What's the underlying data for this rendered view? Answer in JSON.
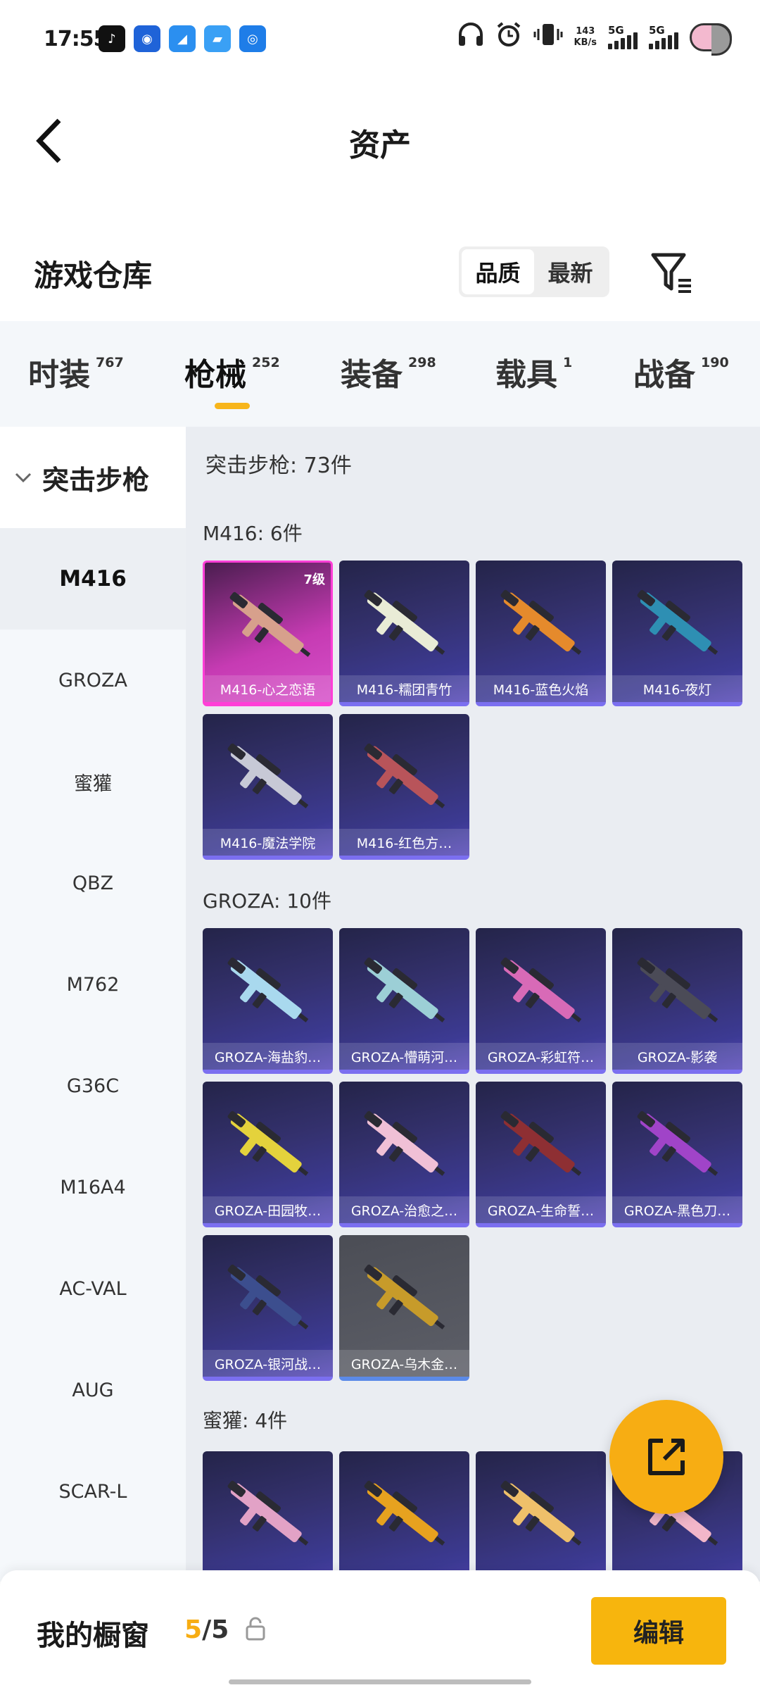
{
  "status_bar": {
    "time": "17:55",
    "net_speed_value": "143",
    "net_speed_unit": "KB/s",
    "sim1": "5G",
    "sim2": "5G",
    "app_icons": [
      "tiktok-icon",
      "chat-bot-icon",
      "blue-app-icon",
      "files-app-icon",
      "radio-app-icon"
    ],
    "system_icons": [
      "headphones-icon",
      "alarm-icon",
      "vibrate-icon",
      "cellular-signal-icon",
      "battery-cloud-icon"
    ]
  },
  "header": {
    "title": "资产"
  },
  "warehouse": {
    "title": "游戏仓库",
    "sort_options": [
      "品质",
      "最新"
    ],
    "active_sort": "品质"
  },
  "tabs": [
    {
      "label": "时装",
      "count": "767"
    },
    {
      "label": "枪械",
      "count": "252",
      "active": true
    },
    {
      "label": "装备",
      "count": "298"
    },
    {
      "label": "载具",
      "count": "1"
    },
    {
      "label": "战备",
      "count": "190"
    }
  ],
  "sidebar": {
    "category": "突击步枪",
    "items": [
      "M416",
      "GROZA",
      "蜜獾",
      "QBZ",
      "M762",
      "G36C",
      "M16A4",
      "AC-VAL",
      "AUG",
      "SCAR-L"
    ],
    "active": "M416"
  },
  "content": {
    "total_label": "突击步枪: 73件",
    "groups": [
      {
        "header": "M416: 6件",
        "items": [
          {
            "name": "M416-心之恋语",
            "level": "7级",
            "rarity": "pink",
            "gun_color": "#d7a08c"
          },
          {
            "name": "M416-糯团青竹",
            "rarity": "purple",
            "gun_color": "#e9ecd6"
          },
          {
            "name": "M416-蓝色火焰",
            "rarity": "purple",
            "gun_color": "#e58a2c"
          },
          {
            "name": "M416-夜灯",
            "rarity": "purple",
            "gun_color": "#2e8fb3"
          },
          {
            "name": "M416-魔法学院",
            "rarity": "purple",
            "gun_color": "#c7c9d6"
          },
          {
            "name": "M416-红色方…",
            "rarity": "purple",
            "gun_color": "#b8545a"
          }
        ]
      },
      {
        "header": "GROZA: 10件",
        "items": [
          {
            "name": "GROZA-海盐豹…",
            "rarity": "purple",
            "gun_color": "#a9d9ee"
          },
          {
            "name": "GROZA-懵萌河…",
            "rarity": "purple",
            "gun_color": "#9ccfd6"
          },
          {
            "name": "GROZA-彩虹符…",
            "rarity": "purple",
            "gun_color": "#d86ab7"
          },
          {
            "name": "GROZA-影袭",
            "rarity": "purple",
            "gun_color": "#4b4b57"
          },
          {
            "name": "GROZA-田园牧…",
            "rarity": "purple",
            "gun_color": "#e4d23c"
          },
          {
            "name": "GROZA-治愈之…",
            "rarity": "purple",
            "gun_color": "#f0c0d6"
          },
          {
            "name": "GROZA-生命誓…",
            "rarity": "purple",
            "gun_color": "#8e2f33"
          },
          {
            "name": "GROZA-黑色刀…",
            "rarity": "purple",
            "gun_color": "#a044c8"
          },
          {
            "name": "GROZA-银河战…",
            "rarity": "purple",
            "gun_color": "#3c4e8e"
          },
          {
            "name": "GROZA-乌木金…",
            "rarity": "grey",
            "gun_color": "#c79b2a"
          }
        ]
      },
      {
        "header": "蜜獾: 4件",
        "items": [
          {
            "name": "",
            "rarity": "purple",
            "gun_color": "#e2a2c6"
          },
          {
            "name": "",
            "rarity": "purple",
            "gun_color": "#e7a21f"
          },
          {
            "name": "",
            "rarity": "purple",
            "gun_color": "#efc06a"
          },
          {
            "name": "",
            "rarity": "purple",
            "gun_color": "#f2b6c9"
          }
        ]
      }
    ]
  },
  "bottom_bar": {
    "title": "我的橱窗",
    "current": "5",
    "separator": "/",
    "total": "5",
    "edit_label": "编辑"
  },
  "colors": {
    "accent": "#f7ad13",
    "tab_indicator": "#f7b51b",
    "card_purple": "#3c3a93",
    "card_pink": "#d650c9"
  }
}
